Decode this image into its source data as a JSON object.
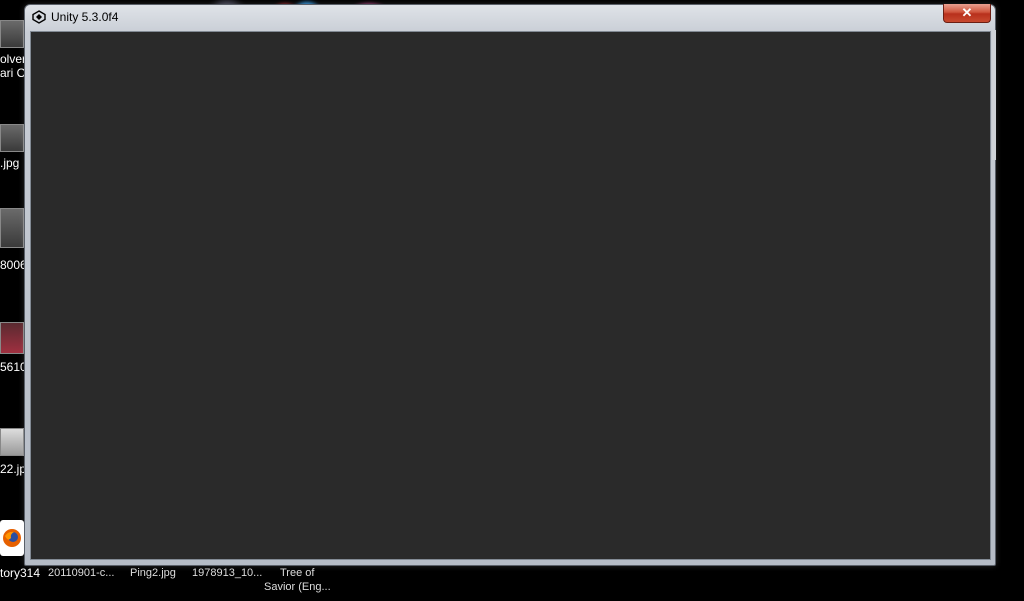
{
  "window": {
    "title": "Unity 5.3.0f4",
    "close_label": "✕",
    "client_color": "#2a2a2a"
  },
  "desktop_icons": [
    {
      "label": "olver",
      "label2": "ari Oi"
    },
    {
      "label": ".jpg"
    },
    {
      "label": "8006"
    },
    {
      "label": "5610"
    },
    {
      "label": "22.jp"
    },
    {
      "label": "tory314"
    }
  ],
  "bottom_labels": [
    {
      "text": "20110901-c..."
    },
    {
      "text": "Ping2.jpg"
    },
    {
      "text": "1978913_10..."
    },
    {
      "text": "Tree of",
      "text2": "Savior (Eng..."
    }
  ]
}
